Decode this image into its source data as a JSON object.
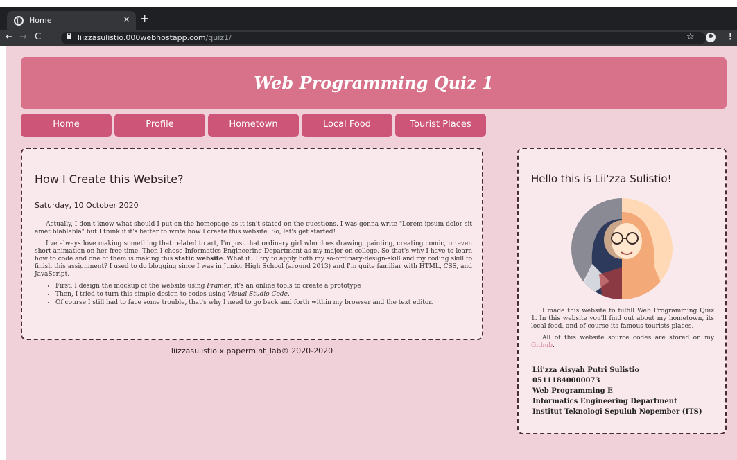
{
  "browser": {
    "tab_title": "Home",
    "tab_close": "×",
    "new_tab": "+",
    "back": "←",
    "forward": "→",
    "reload": "C",
    "url_host": "liizzasulistio.000webhostapp.com",
    "url_path": "/quiz1/",
    "star": "☆",
    "menu": "⋮"
  },
  "header": {
    "title": "Web Programming Quiz 1"
  },
  "nav": {
    "items": [
      {
        "label": "Home"
      },
      {
        "label": "Profile"
      },
      {
        "label": "Hometown"
      },
      {
        "label": "Local Food"
      },
      {
        "label": "Tourist Places"
      }
    ]
  },
  "article": {
    "title": "How I Create this Website?",
    "date": "Saturday, 10 October 2020",
    "p1": "Actually, I don't know what should I put on the homepage as it isn't stated on the questions. I was gonna write \"Lorem ipsum dolor sit amet blablabla\" but I think if it's better to write how I create this website. So, let's get started!",
    "p2_a": "I've always love making something that related to art, I'm just that ordinary girl who does drawing, painting, creating comic, or even short animation on her free time. Then I chose Informatics Engineering Department as my major on college. So that's why I have to learn how to code and one of them is making this ",
    "p2_bold": "static website",
    "p2_b": ". What if.. I try to apply both my so-ordinary-design-skill and my coding skill to finish this assignment? I used to do blogging since I was in Junior High School (around 2013) and I'm quite familiar with HTML, CSS, and JavaScript.",
    "li1_a": "First, I design the mockup of the website using ",
    "li1_em": "Framer",
    "li1_b": ", it's an online tools to create a prototype",
    "li2_a": "Then, I tried to turn this simple design to codes using ",
    "li2_em": "Visual Studio Code",
    "li2_b": ".",
    "li3": "Of course I still had to face some trouble, that's why I need to go back and forth within my browser and the text editor."
  },
  "footer": {
    "text": "liizzasulistio x papermint_lab® 2020-2020"
  },
  "sidebar": {
    "greeting": "Hello this is Lii'zza Sulistio!",
    "p1": "I made this website to fulfill Web Programming Quiz 1. In this website you'll find out about my hometown, its local food, and of course its famous tourists places.",
    "p2": "All of this website source codes are stored on my ",
    "github": "Github",
    "p2_end": ".",
    "info": [
      "Lii'zza Aisyah Putri Sulistio",
      "05111840000073",
      "Web Programming E",
      "Informatics Engineering Department",
      "Institut Teknologi Sepuluh Nopember (ITS)"
    ]
  },
  "colors": {
    "page_bg": "#f1d1d9",
    "header_bg": "#d8728a",
    "nav_bg": "#cd5578",
    "card_bg": "#f9e8ec",
    "link": "#d07a98"
  }
}
